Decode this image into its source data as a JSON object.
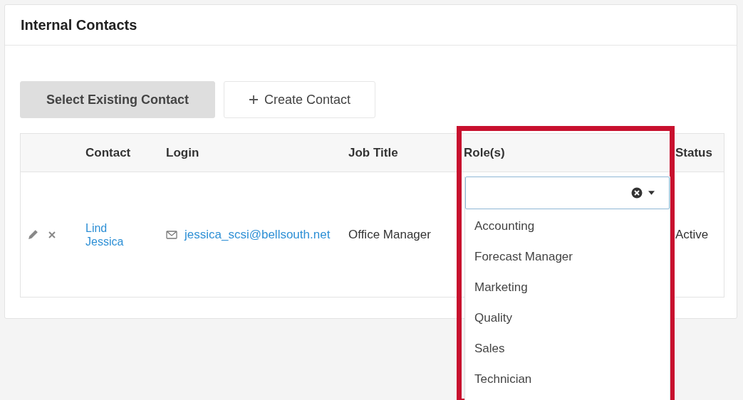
{
  "panel": {
    "title": "Internal Contacts"
  },
  "buttons": [
    {
      "label": "Select Existing Contact",
      "selected": true,
      "kind": "plain"
    },
    {
      "label": "Create Contact",
      "selected": false,
      "kind": "add"
    }
  ],
  "table": {
    "columns": [
      "",
      "Contact",
      "Login",
      "Job Title",
      "Role(s)",
      "Status"
    ],
    "rows": [
      {
        "contact": [
          "Lind",
          "Jessica"
        ],
        "login": "jessica_scsi@bellsouth.net",
        "job_title": "Office Manager",
        "status": "Active"
      }
    ]
  },
  "roles_dropdown": {
    "expanded": true,
    "options": [
      "Accounting",
      "Forecast Manager",
      "Marketing",
      "Quality",
      "Sales",
      "Technician"
    ]
  },
  "highlight": {
    "color": "#c8102e"
  }
}
